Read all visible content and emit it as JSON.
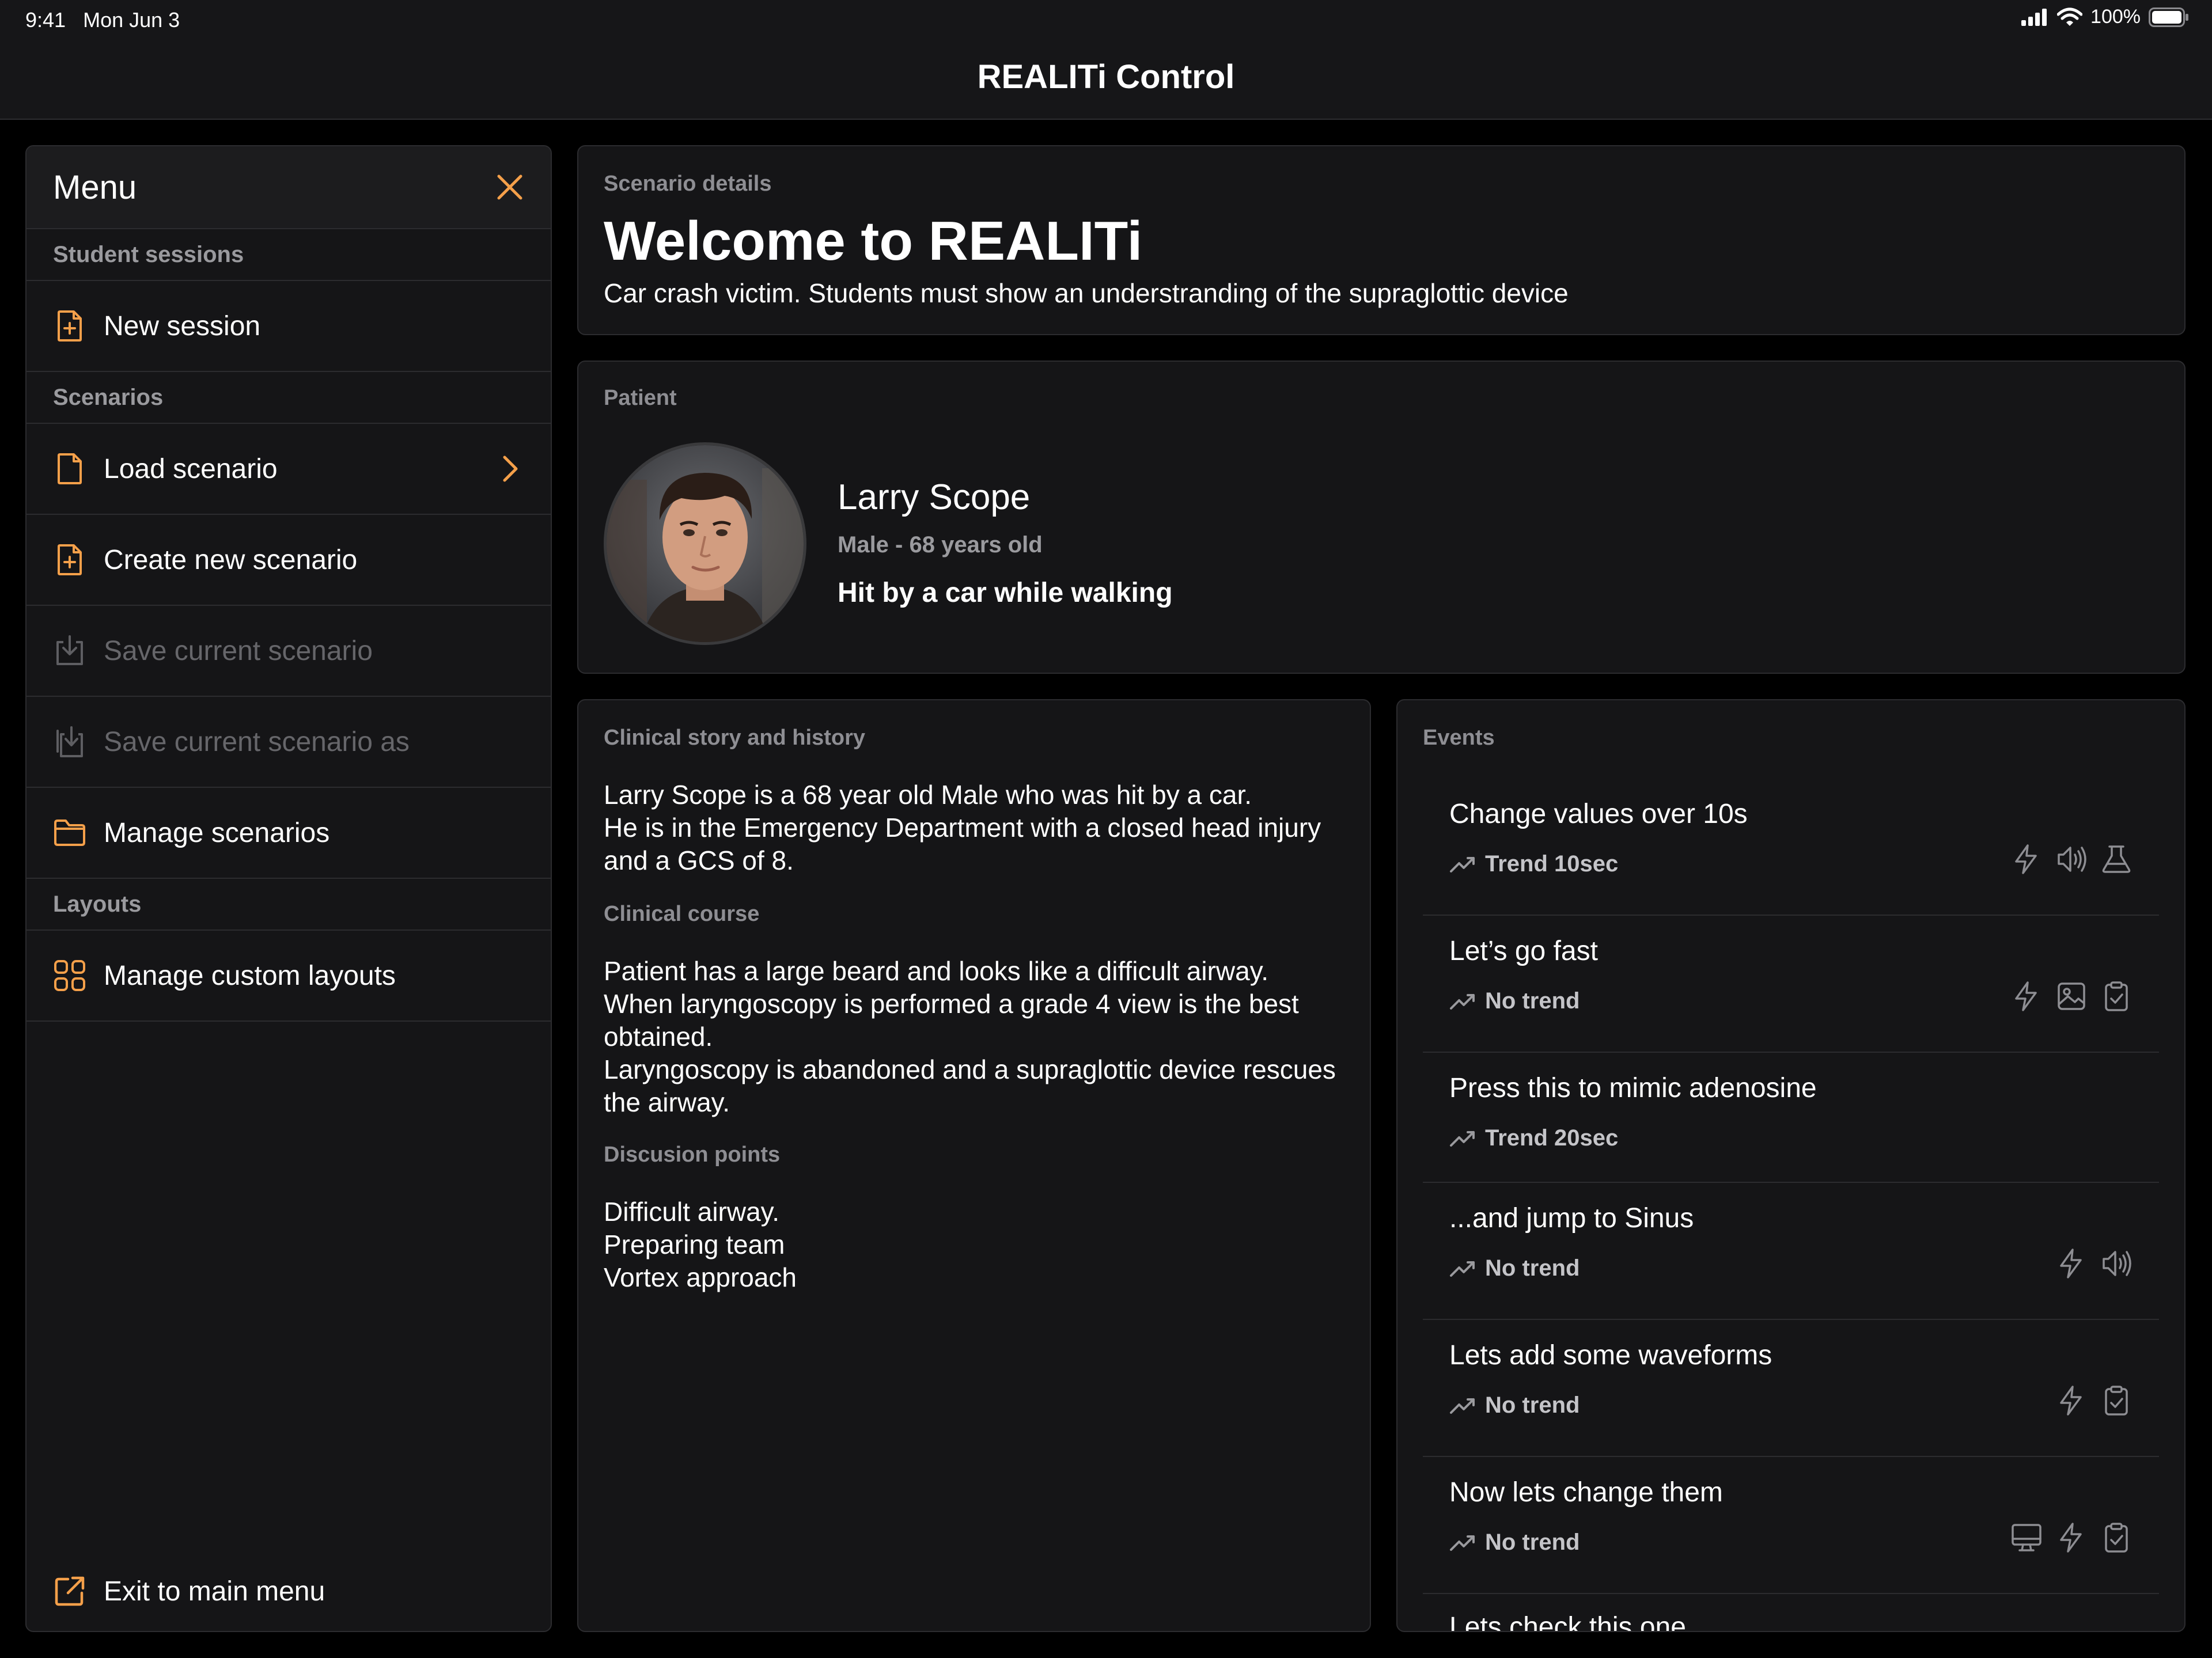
{
  "status_bar": {
    "time": "9:41",
    "date": "Mon Jun 3",
    "battery": "100%"
  },
  "app": {
    "title": "REALITi Control"
  },
  "sidebar": {
    "title": "Menu",
    "sections": [
      {
        "label": "Student sessions"
      },
      {
        "label": "Scenarios"
      },
      {
        "label": "Layouts"
      }
    ],
    "items": [
      {
        "label": "New session",
        "icon": "file-plus-icon",
        "enabled": true
      },
      {
        "label": "Load scenario",
        "icon": "file-icon",
        "enabled": true
      },
      {
        "label": "Create new scenario",
        "icon": "file-plus-icon",
        "enabled": true
      },
      {
        "label": "Save current scenario",
        "icon": "save-icon",
        "enabled": false
      },
      {
        "label": "Save current scenario as",
        "icon": "save-as-icon",
        "enabled": false
      },
      {
        "label": "Manage scenarios",
        "icon": "folder-icon",
        "enabled": true
      },
      {
        "label": "Manage custom layouts",
        "icon": "grid-icon",
        "enabled": true
      }
    ],
    "exit_label": "Exit to main menu"
  },
  "scenario": {
    "section_label": "Scenario details",
    "title": "Welcome to REALITi",
    "description": "Car crash victim. Students must show an understranding of the supraglottic device"
  },
  "patient": {
    "section_label": "Patient",
    "name": "Larry Scope",
    "info": "Male - 68 years old",
    "story": "Hit by a car while walking"
  },
  "clinical": {
    "section_label": "Clinical story and history",
    "story": "Larry Scope is a 68 year old Male who was hit by a car.\nHe is in the Emergency Department with a closed head injury and a GCS of 8.",
    "course_label": "Clinical course",
    "course": "Patient has a large beard and looks like a difficult airway.\nWhen laryngoscopy is performed a grade 4 view is the best obtained.\nLaryngoscopy is abandoned and a supraglottic device rescues the airway.",
    "discussion_label": "Discusion points",
    "discussion": "Difficult airway.\nPreparing team\nVortex approach"
  },
  "events": {
    "section_label": "Events",
    "items": [
      {
        "title": "Change values over 10s",
        "trend": "Trend 10sec",
        "icons": [
          "bolt-icon",
          "speaker-icon",
          "flask-icon"
        ]
      },
      {
        "title": "Let’s go fast",
        "trend": "No trend",
        "icons": [
          "bolt-icon",
          "image-icon",
          "clipboard-icon"
        ]
      },
      {
        "title": "Press this to mimic adenosine",
        "trend": "Trend 20sec",
        "icons": []
      },
      {
        "title": "...and jump to Sinus",
        "trend": "No trend",
        "icons": [
          "bolt-icon",
          "speaker-icon"
        ]
      },
      {
        "title": "Lets add some waveforms",
        "trend": "No trend",
        "icons": [
          "bolt-icon",
          "clipboard-icon"
        ]
      },
      {
        "title": "Now lets change them",
        "trend": "No trend",
        "icons": [
          "monitor-icon",
          "bolt-icon",
          "clipboard-icon"
        ]
      },
      {
        "title": "Lets check this one",
        "trend": "",
        "icons": []
      }
    ]
  },
  "colors": {
    "accent": "#F5A04A",
    "background": "#000000",
    "panel": "#151517",
    "divider": "#2C2C2F",
    "muted": "#8E8E93"
  }
}
